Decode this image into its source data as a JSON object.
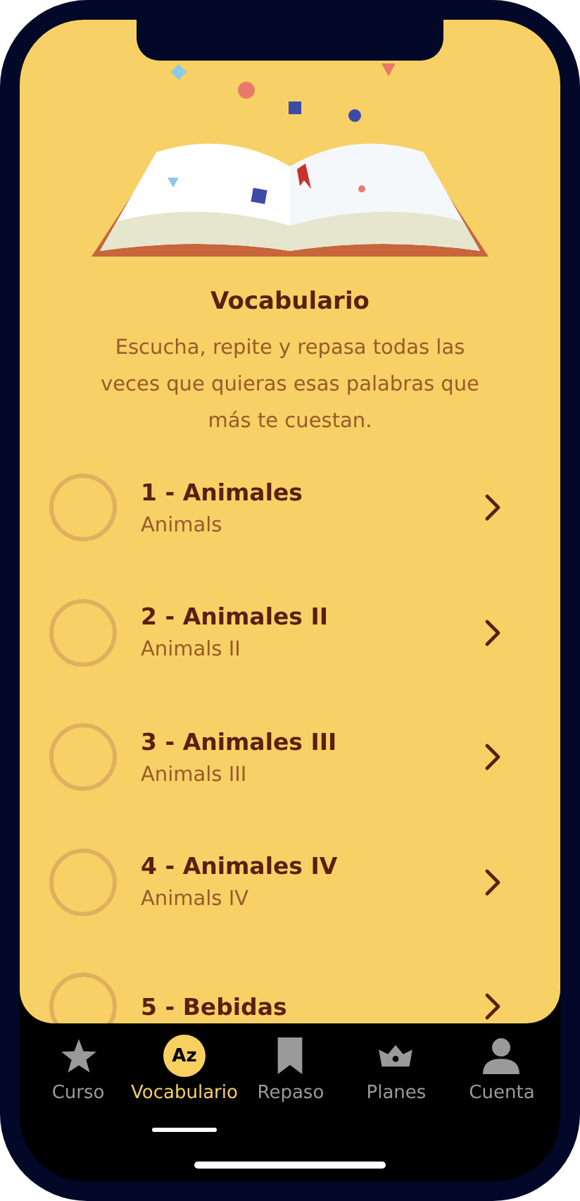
{
  "header": {
    "title": "Vocabulario",
    "description": "Escucha, repite y repasa todas las veces que quieras esas palabras que más te cuestan."
  },
  "lessons": [
    {
      "title": "1 - Animales",
      "subtitle": "Animals"
    },
    {
      "title": "2 - Animales II",
      "subtitle": "Animals II"
    },
    {
      "title": "3 - Animales III",
      "subtitle": "Animals III"
    },
    {
      "title": "4 - Animales IV",
      "subtitle": "Animals IV"
    },
    {
      "title": "5 - Bebidas"
    }
  ],
  "tabs": [
    {
      "label": "Curso",
      "kind": "star",
      "selected": false
    },
    {
      "label": "Vocabulario",
      "kind": "badge",
      "icon_text": "Az",
      "selected": true
    },
    {
      "label": "Repaso",
      "kind": "bookmark",
      "selected": false
    },
    {
      "label": "Planes",
      "kind": "crown",
      "selected": false
    },
    {
      "label": "Cuenta",
      "kind": "person",
      "selected": false
    }
  ]
}
